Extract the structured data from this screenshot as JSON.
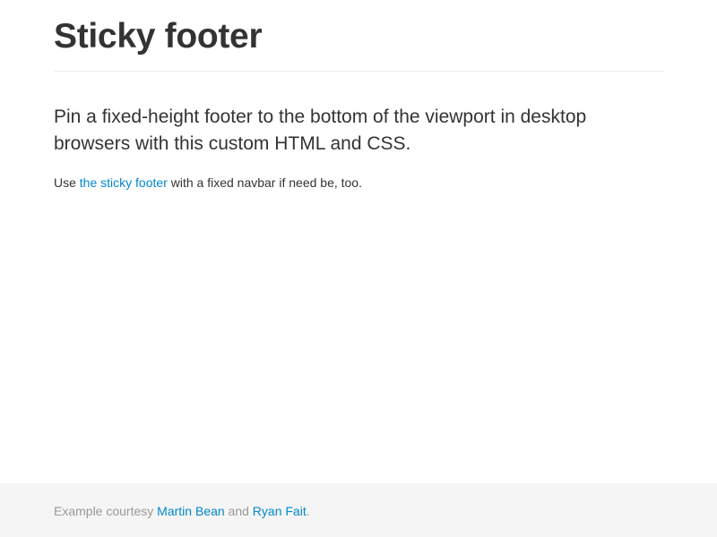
{
  "header": {
    "title": "Sticky footer"
  },
  "main": {
    "lead": "Pin a fixed-height footer to the bottom of the viewport in desktop browsers with this custom HTML and CSS.",
    "body_prefix": "Use ",
    "body_link": "the sticky footer",
    "body_suffix": " with a fixed navbar if need be, too."
  },
  "footer": {
    "prefix": "Example courtesy ",
    "link1": "Martin Bean",
    "middle": " and ",
    "link2": "Ryan Fait",
    "suffix": "."
  },
  "colors": {
    "link": "#0088cc",
    "text": "#333333",
    "muted": "#999999",
    "footer_bg": "#f5f5f5",
    "divider": "#eeeeee"
  }
}
